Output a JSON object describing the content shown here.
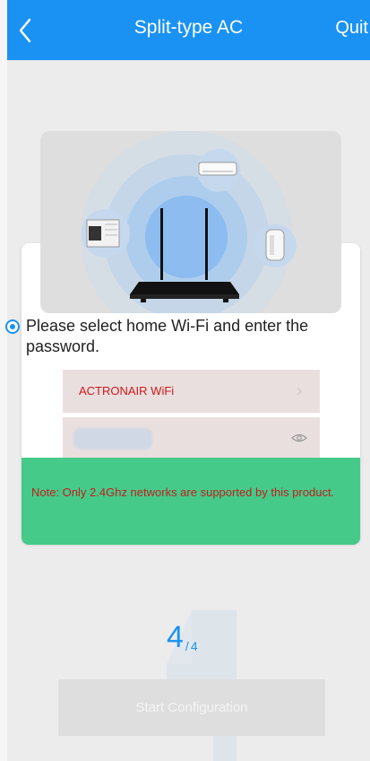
{
  "header": {
    "title": "Split-type AC",
    "quit_label": "Quit",
    "background": "#1a92f3"
  },
  "instruction": {
    "text": "Please select home Wi-Fi and enter the password."
  },
  "wifi": {
    "ssid": "ACTRONAIR WiFi"
  },
  "note": {
    "text": "Note: Only 2.4Ghz networks are supported by this product.",
    "background": "#45ca8a"
  },
  "step": {
    "current": "4",
    "separator": "/",
    "total": "4"
  },
  "start_button": {
    "label": "Start Configuration"
  },
  "icons": [
    "back-arrow-icon",
    "chevron-right-icon",
    "eye-icon",
    "router-icon",
    "air-conditioner-icon",
    "dehumidifier-icon",
    "window-ac-icon"
  ]
}
